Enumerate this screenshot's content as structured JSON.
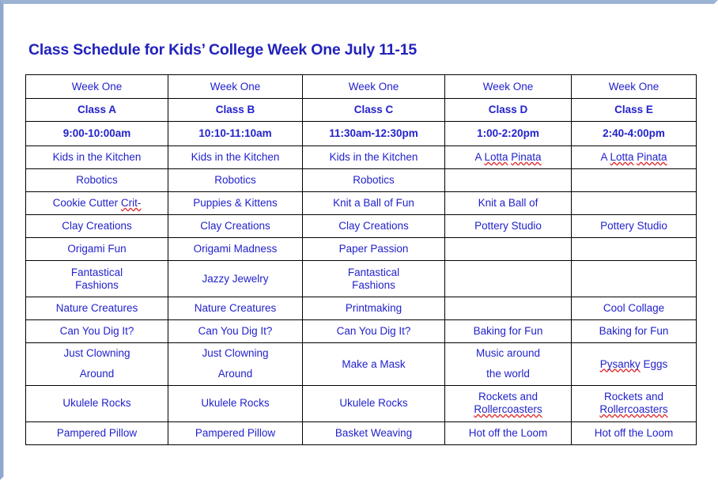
{
  "document": {
    "title": "Class Schedule for Kids’ College Week One July 11-15",
    "title_color": "#2222bb",
    "body_text_color": "#2222cc",
    "header_text_color": "#000000",
    "border_color": "#000000",
    "page_background": "#ffffff",
    "page_frame_color": "#9db3d4",
    "spellcheck_underline_color": "#e03030"
  },
  "table": {
    "column_count": 5,
    "row_count": 15,
    "header_rows": {
      "week": [
        "Week One",
        "Week One",
        "Week One",
        "Week One",
        "Week One"
      ],
      "class": [
        "Class A",
        "Class B",
        "Class C",
        "Class D",
        "Class E"
      ],
      "time": [
        "9:00-10:00am",
        "10:10-11:10am",
        "11:30am-12:30pm",
        "1:00-2:20pm",
        "2:40-4:00pm"
      ]
    },
    "rows": [
      {
        "cells": [
          {
            "text": "Kids in the Kitchen"
          },
          {
            "text": "Kids in the Kitchen"
          },
          {
            "text": "Kids in the Kitchen"
          },
          {
            "text": "A Lotta Pinata",
            "spellcheck": [
              "Lotta",
              "Pinata"
            ]
          },
          {
            "text": "A Lotta Pinata",
            "spellcheck": [
              "Lotta",
              "Pinata"
            ]
          }
        ]
      },
      {
        "cells": [
          {
            "text": "Robotics"
          },
          {
            "text": "Robotics"
          },
          {
            "text": "Robotics"
          },
          {
            "text": ""
          },
          {
            "text": ""
          }
        ]
      },
      {
        "cells": [
          {
            "text": "Cookie Cutter Crit-",
            "spellcheck": [
              "Crit"
            ]
          },
          {
            "text": "Puppies & Kittens"
          },
          {
            "text": "Knit a Ball of Fun"
          },
          {
            "text": "Knit a Ball of"
          },
          {
            "text": ""
          }
        ]
      },
      {
        "cells": [
          {
            "text": "Clay Creations"
          },
          {
            "text": "Clay Creations"
          },
          {
            "text": "Clay Creations"
          },
          {
            "text": "Pottery Studio"
          },
          {
            "text": "Pottery Studio"
          }
        ]
      },
      {
        "cells": [
          {
            "text": "Origami  Fun"
          },
          {
            "text": "Origami  Madness"
          },
          {
            "text": "Paper Passion"
          },
          {
            "text": ""
          },
          {
            "text": ""
          }
        ]
      },
      {
        "tall": true,
        "cells": [
          {
            "lines": [
              "Fantastical",
              "Fashions"
            ]
          },
          {
            "text": "Jazzy Jewelry"
          },
          {
            "lines": [
              "Fantastical",
              "Fashions"
            ]
          },
          {
            "text": ""
          },
          {
            "text": ""
          }
        ]
      },
      {
        "cells": [
          {
            "text": "Nature Creatures"
          },
          {
            "text": "Nature Creatures"
          },
          {
            "text": "Printmaking"
          },
          {
            "text": ""
          },
          {
            "text": "Cool Collage"
          }
        ]
      },
      {
        "cells": [
          {
            "text": "Can You Dig It?"
          },
          {
            "text": "Can You Dig It?"
          },
          {
            "text": "Can You Dig It?"
          },
          {
            "text": "Baking for Fun"
          },
          {
            "text": "Baking for Fun"
          }
        ]
      },
      {
        "tall2": true,
        "cells": [
          {
            "lines_wide": [
              "Just Clowning",
              "Around"
            ]
          },
          {
            "lines_wide": [
              "Just Clowning",
              "Around"
            ]
          },
          {
            "text": "Make a Mask"
          },
          {
            "lines_wide": [
              "Music around",
              "the world"
            ]
          },
          {
            "text": "Pysanky  Eggs",
            "spellcheck": [
              "Pysanky"
            ]
          }
        ]
      },
      {
        "tall": true,
        "cells": [
          {
            "text": "Ukulele Rocks"
          },
          {
            "text": "Ukulele Rocks"
          },
          {
            "text": "Ukulele Rocks"
          },
          {
            "lines": [
              "Rockets  and",
              "Rollercoasters"
            ],
            "spellcheck": [
              "Rollercoasters"
            ]
          },
          {
            "lines": [
              "Rockets and",
              "Rollercoasters"
            ],
            "spellcheck": [
              "Rollercoasters"
            ]
          }
        ]
      },
      {
        "cells": [
          {
            "text": "Pampered  Pillow"
          },
          {
            "text": "Pampered  Pillow"
          },
          {
            "text": "Basket Weaving"
          },
          {
            "text": "Hot off the Loom"
          },
          {
            "text": "Hot off the Loom"
          }
        ]
      }
    ]
  }
}
